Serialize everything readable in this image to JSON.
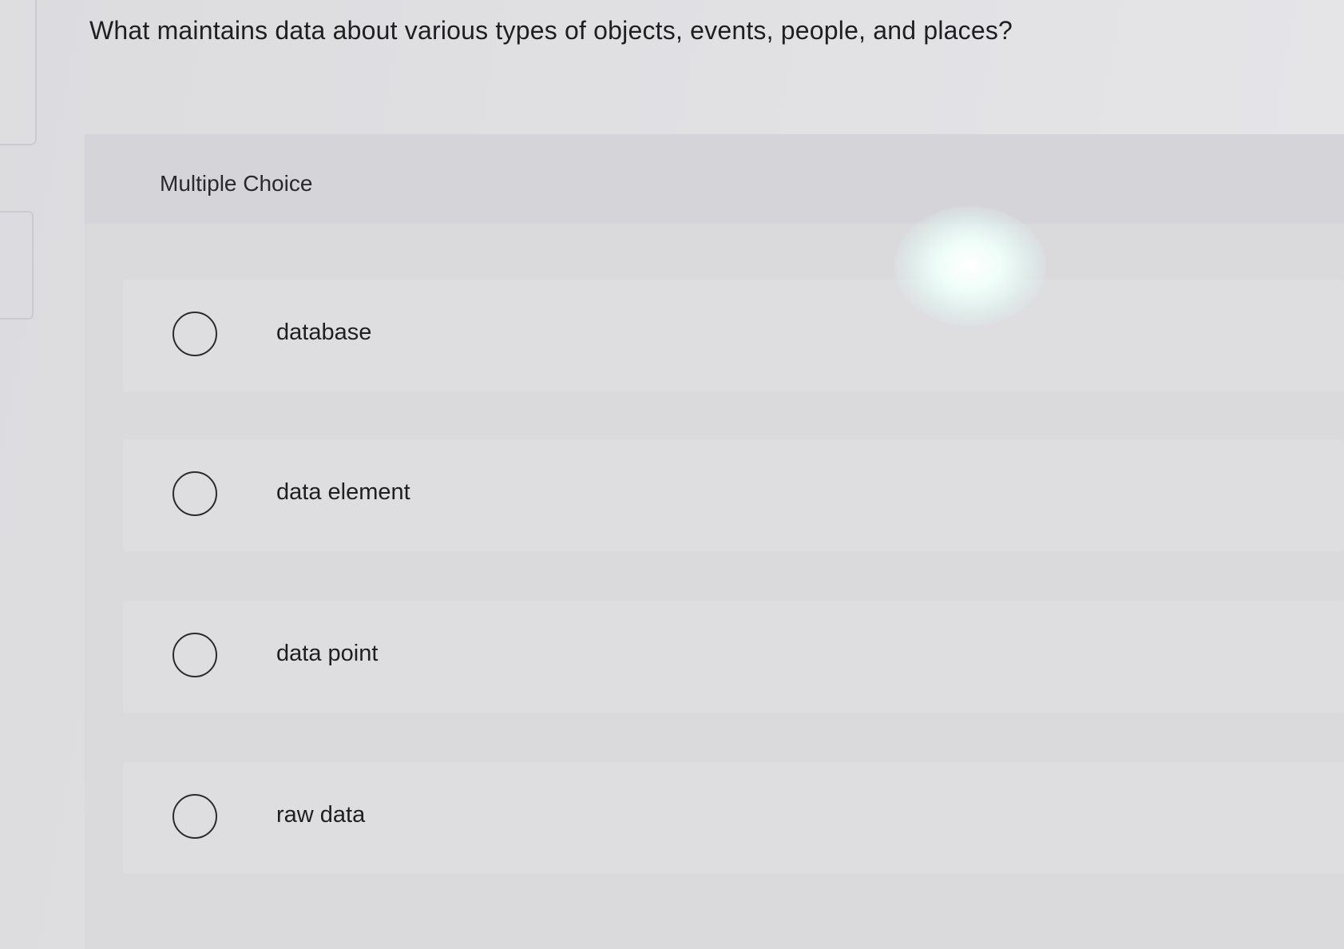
{
  "question": {
    "text": "What maintains data about various types of objects, events, people, and places?"
  },
  "quiz": {
    "type_label": "Multiple Choice",
    "options": [
      {
        "label": "database"
      },
      {
        "label": "data element"
      },
      {
        "label": "data point"
      },
      {
        "label": "raw data"
      }
    ]
  },
  "icons": {
    "radio": "radio-unselected-icon"
  }
}
